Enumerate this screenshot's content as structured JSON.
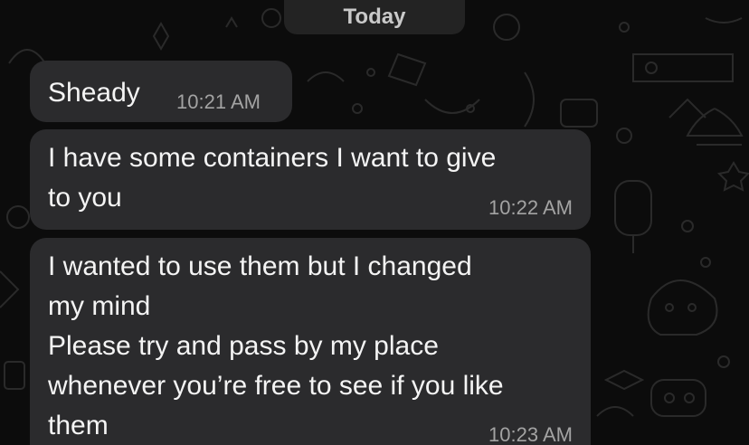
{
  "date_divider": {
    "label": "Today"
  },
  "messages": [
    {
      "lines": [
        "Sheady"
      ],
      "time": "10:21 AM"
    },
    {
      "lines": [
        "I have some containers I want to give",
        "to you"
      ],
      "time": "10:22 AM"
    },
    {
      "lines": [
        "I wanted to use them but I changed",
        "my mind",
        "Please try and pass by my place",
        "whenever you’re free to see if you like",
        "them"
      ],
      "time": "10:23 AM"
    }
  ],
  "colors": {
    "background": "#0c0c0c",
    "bubble": "#2b2b2d",
    "text": "#f4f4f4",
    "timestamp": "#a3a3a3",
    "doodle": "#5a5a5a"
  }
}
